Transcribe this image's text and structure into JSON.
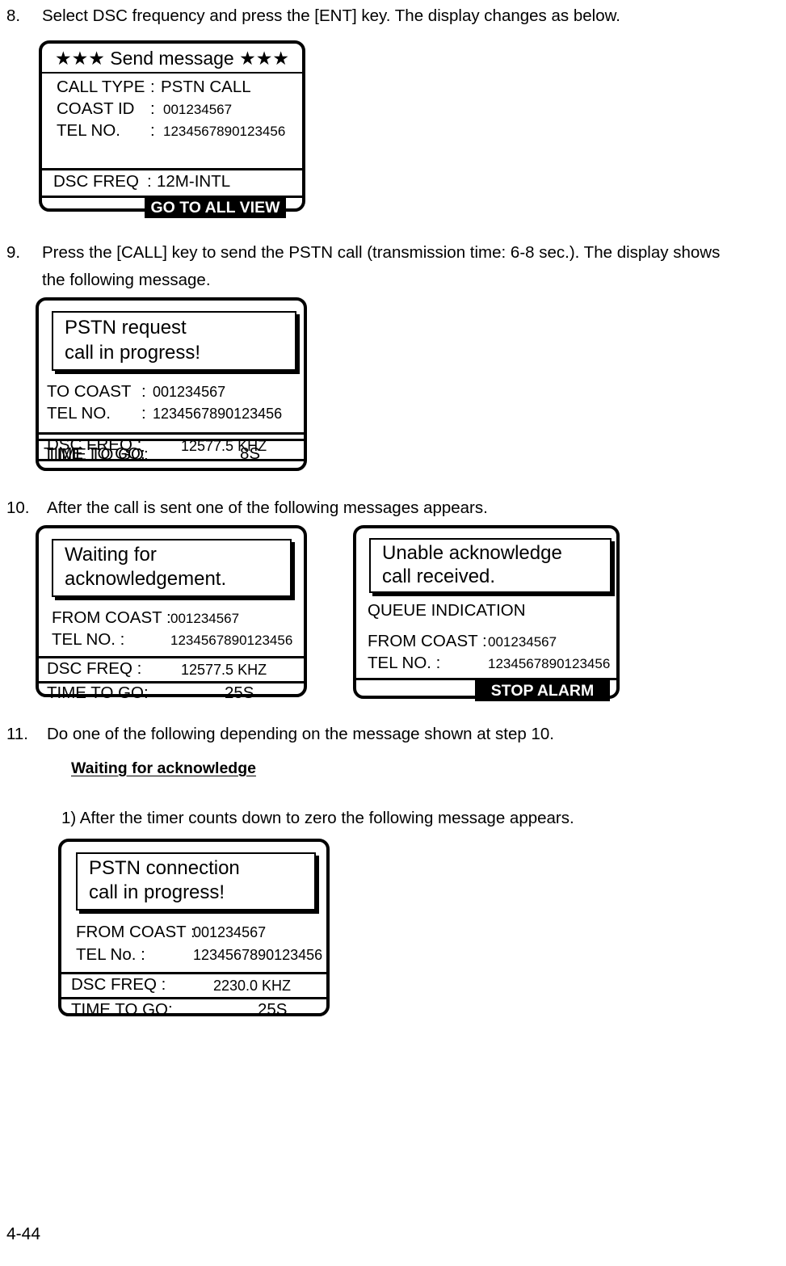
{
  "page": {
    "number": "4-44"
  },
  "steps": [
    {
      "num": "8.",
      "line1": "Select DSC frequency and press the [ENT] key. The display changes as below.",
      "line2": ""
    },
    {
      "num": "9.",
      "line1": "Press the [CALL] key to send the PSTN call (transmission time: 6-8 sec.). The display shows",
      "line2": "the following message."
    },
    {
      "num": "10.",
      "line1": "After the call is sent one of the following messages appears.",
      "line2": ""
    },
    {
      "num": "11.",
      "line1": "Do one of the following depending on the message shown at step 10.",
      "line2": ""
    }
  ],
  "subheading": "Waiting for acknowledge",
  "substep": "1) After the timer counts down to zero the following message appears.",
  "panel_send_message": {
    "title": "★★★ Send message ★★★",
    "rows": [
      {
        "label": "CALL TYPE",
        "colon": ":",
        "value": "PSTN CALL"
      },
      {
        "label": "COAST  ID",
        "colon": ":",
        "value": "001234567"
      },
      {
        "label": "TEL NO.",
        "colon": ":",
        "value": "1234567890123456"
      }
    ],
    "freq_label": "DSC FREQ",
    "freq_colon": ":",
    "freq_value": "12M-INTL",
    "softkey": "GO TO ALL VIEW"
  },
  "panel_pstn_request": {
    "message_line1": "PSTN request",
    "message_line2": "call in progress!",
    "rows": [
      {
        "label": "TO COAST",
        "colon": ":",
        "value": "001234567"
      },
      {
        "label": "TEL NO.",
        "colon": ":",
        "value": "1234567890123456"
      }
    ],
    "freq_label": "DSC FREQ  :",
    "freq_value": "12577.5 KHZ",
    "timer_label": "TIME TO GO:",
    "timer_value": "8S"
  },
  "panel_waiting_ack": {
    "message_line1": "Waiting for",
    "message_line2": "acknowledgement.",
    "rows": [
      {
        "label": "FROM COAST :",
        "value": "001234567"
      },
      {
        "label": "TEL NO.     :",
        "value": "1234567890123456"
      }
    ],
    "freq_label": "DSC FREQ  :",
    "freq_value": "12577.5 KHZ",
    "timer_label": "TIME TO GO:",
    "timer_value": "25S"
  },
  "panel_unable_ack": {
    "message_line1": "Unable acknowledge",
    "message_line2": "call received.",
    "queue_label": "QUEUE INDICATION",
    "rows": [
      {
        "label": "FROM COAST :",
        "value": "001234567"
      },
      {
        "label": "TEL NO.     :",
        "value": "1234567890123456"
      }
    ],
    "softkey": "STOP ALARM"
  },
  "panel_pstn_connection": {
    "message_line1": "PSTN  connection",
    "message_line2": "call in progress!",
    "rows": [
      {
        "label": "FROM COAST :",
        "value": "001234567"
      },
      {
        "label": "TEL No.      :",
        "value": "1234567890123456"
      }
    ],
    "freq_label": "DSC FREQ  :",
    "freq_value": "2230.0 KHZ",
    "timer_label": "TIME TO GO:",
    "timer_value": "25S"
  }
}
